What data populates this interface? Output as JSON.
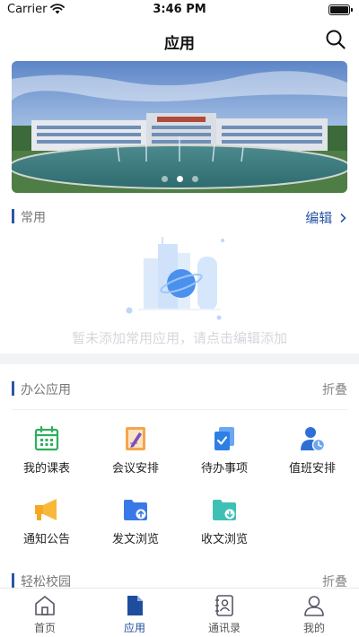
{
  "status_bar": {
    "carrier": "Carrier",
    "time": "3:46 PM",
    "battery_level": 1.0
  },
  "navbar": {
    "title": "应用"
  },
  "banner": {
    "slide_count": 3,
    "active_index": 1
  },
  "favorites": {
    "title": "常用",
    "action": "编辑",
    "empty_text": "暂未添加常用应用，请点击编辑添加"
  },
  "office": {
    "title": "办公应用",
    "action": "折叠",
    "apps": [
      {
        "label": "我的课表",
        "icon": "calendar-icon"
      },
      {
        "label": "会议安排",
        "icon": "meeting-doc-icon"
      },
      {
        "label": "待办事项",
        "icon": "todo-icon"
      },
      {
        "label": "值班安排",
        "icon": "duty-person-icon"
      },
      {
        "label": "通知公告",
        "icon": "megaphone-icon"
      },
      {
        "label": "发文浏览",
        "icon": "folder-upload-icon"
      },
      {
        "label": "收文浏览",
        "icon": "folder-download-icon"
      }
    ]
  },
  "campus": {
    "title": "轻松校园",
    "action": "折叠"
  },
  "tabbar": {
    "active": "应用",
    "tabs": [
      {
        "label": "首页",
        "icon": "home-icon"
      },
      {
        "label": "应用",
        "icon": "apps-doc-icon"
      },
      {
        "label": "通讯录",
        "icon": "contacts-icon"
      },
      {
        "label": "我的",
        "icon": "profile-icon"
      }
    ]
  },
  "colors": {
    "accent": "#2a56a5",
    "section_bar": "#2a56a5",
    "empty_text": "#d4d7dc"
  }
}
